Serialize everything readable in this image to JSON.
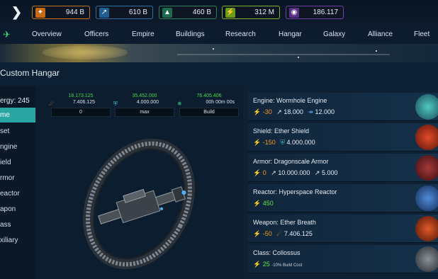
{
  "resources": [
    {
      "icon": "ore-icon",
      "value": "944 B"
    },
    {
      "icon": "crystal-icon",
      "value": "610 B"
    },
    {
      "icon": "gas-icon",
      "value": "460 B"
    },
    {
      "icon": "energy-icon",
      "value": "312 M"
    },
    {
      "icon": "dark-matter-icon",
      "value": "186.117"
    }
  ],
  "nav": [
    "Overview",
    "Officers",
    "Empire",
    "Buildings",
    "Research",
    "Hangar",
    "Galaxy",
    "Alliance",
    "Fleet"
  ],
  "page_title": "Custom Hangar",
  "energy_label": "ergy: 245",
  "sidebar": [
    "me",
    "set",
    "ngine",
    "ield",
    "rmor",
    "eactor",
    "apon",
    "ass",
    "xiliary"
  ],
  "stats": [
    {
      "icon": "attack-icon",
      "top": "18.173.125",
      "mid": "7.406.125",
      "field": "0"
    },
    {
      "icon": "shield-icon",
      "top": "35.452.000",
      "mid": "4.000.000",
      "field": "max"
    },
    {
      "icon": "speed-icon",
      "top": "76.405.406",
      "mid": "00h 00m 00s",
      "field": "Build"
    }
  ],
  "components": [
    {
      "name": "Engine: Wormhole Engine",
      "energy": "-30",
      "a": "18.000",
      "b": "12.000"
    },
    {
      "name": "Shield: Ether Shield",
      "energy": "-150",
      "a": "4.000.000"
    },
    {
      "name": "Armor: Dragonscale Armor",
      "energy": "0",
      "a": "10.000.000",
      "b": "5.000"
    },
    {
      "name": "Reactor: Hyperspace Reactor",
      "energy": "450"
    },
    {
      "name": "Weapon: Ether Breath",
      "energy": "-50",
      "a": "7.406.125"
    },
    {
      "name": "Class: Collossus",
      "energy": "25",
      "note": "-10% Build Cost"
    }
  ],
  "colors": {
    "accent": "#29a6a2",
    "positive": "#62e14c",
    "negative": "#f39a25",
    "energy": "#ffd21e"
  }
}
